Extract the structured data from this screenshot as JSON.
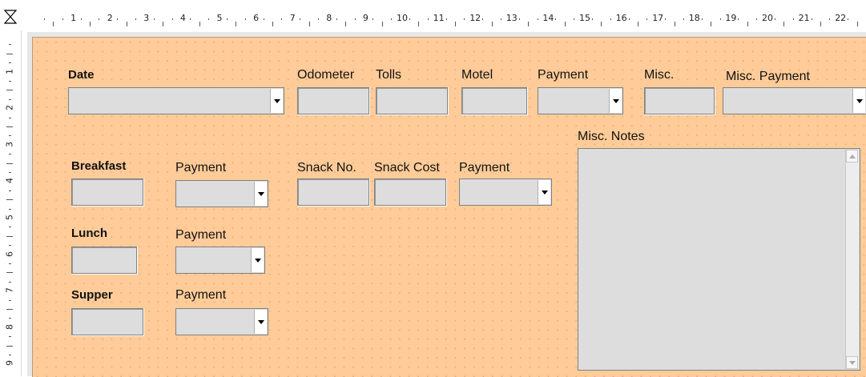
{
  "ruler": {
    "horizontal_marks": [
      "1",
      "2",
      "3",
      "4",
      "5",
      "6",
      "7",
      "8",
      "9",
      "10",
      "11",
      "12",
      "13",
      "14",
      "15",
      "16",
      "17",
      "18",
      "19",
      "20",
      "21",
      "22"
    ],
    "vertical_marks": [
      "1",
      "2",
      "3",
      "4",
      "5",
      "6",
      "7",
      "8",
      "9"
    ]
  },
  "form": {
    "background_color": "#ffcc99",
    "labels": {
      "date": "Date",
      "odometer": "Odometer",
      "tolls": "Tolls",
      "motel": "Motel",
      "payment_top": "Payment",
      "misc": "Misc.",
      "misc_payment": "Misc. Payment",
      "misc_notes": "Misc. Notes",
      "breakfast": "Breakfast",
      "breakfast_payment": "Payment",
      "snack_no": "Snack No.",
      "snack_cost": "Snack Cost",
      "snack_payment": "Payment",
      "lunch": "Lunch",
      "lunch_payment": "Payment",
      "supper": "Supper",
      "supper_payment": "Payment"
    }
  }
}
